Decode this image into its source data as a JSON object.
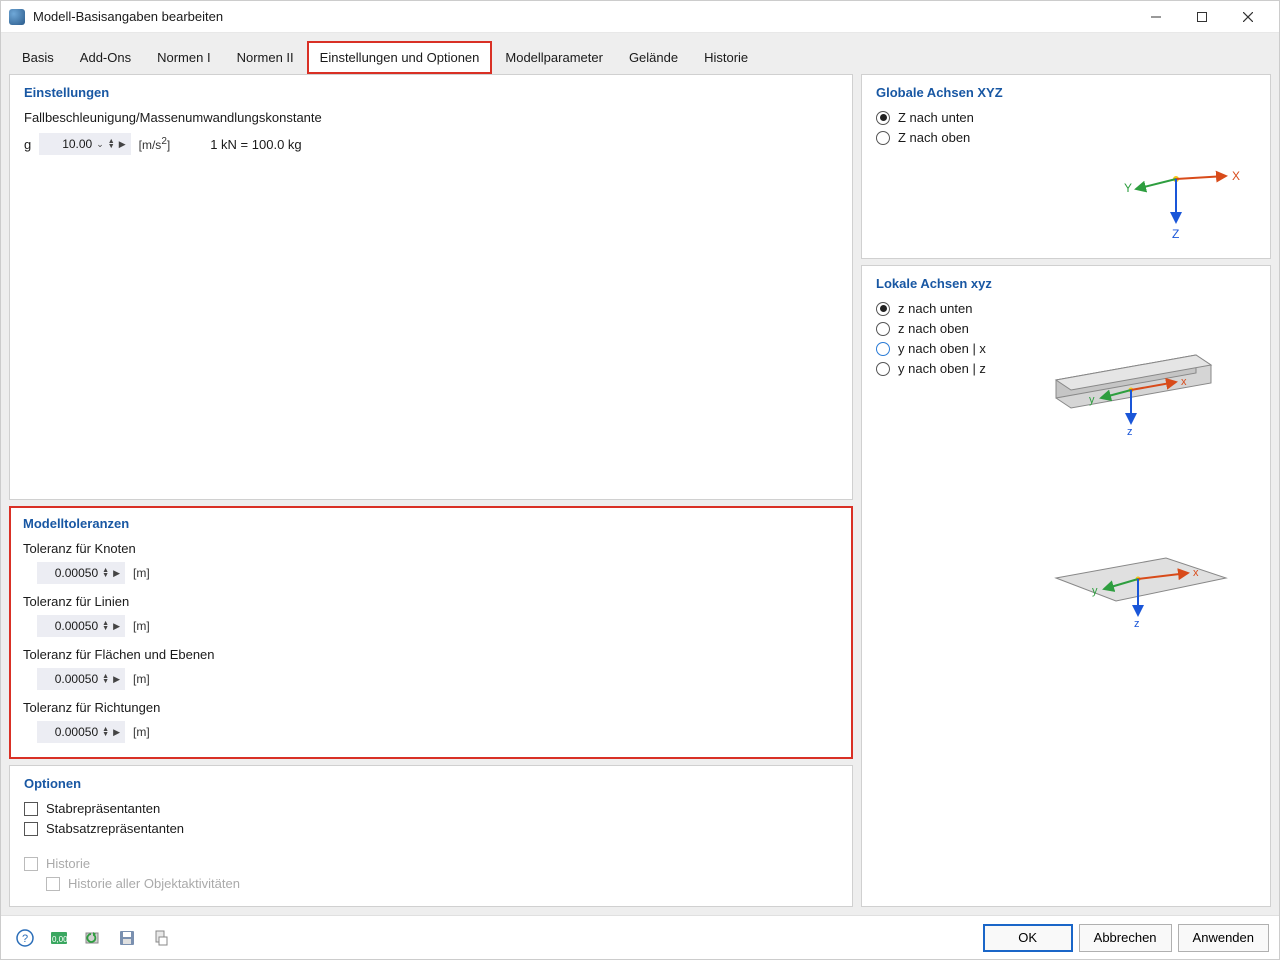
{
  "window": {
    "title": "Modell-Basisangaben bearbeiten"
  },
  "tabs": [
    {
      "label": "Basis"
    },
    {
      "label": "Add-Ons"
    },
    {
      "label": "Normen I"
    },
    {
      "label": "Normen II"
    },
    {
      "label": "Einstellungen und Optionen"
    },
    {
      "label": "Modellparameter"
    },
    {
      "label": "Gelände"
    },
    {
      "label": "Historie"
    }
  ],
  "settings": {
    "title": "Einstellungen",
    "gravity_label": "Fallbeschleunigung/Massenumwandlungskonstante",
    "g_symbol": "g",
    "g_value": "10.00",
    "g_unit": "[m/s²]",
    "kn_label": "1 kN = 100.0 kg"
  },
  "tolerances": {
    "title": "Modelltoleranzen",
    "items": [
      {
        "label": "Toleranz für Knoten",
        "value": "0.00050",
        "unit": "[m]"
      },
      {
        "label": "Toleranz für Linien",
        "value": "0.00050",
        "unit": "[m]"
      },
      {
        "label": "Toleranz für Flächen und Ebenen",
        "value": "0.00050",
        "unit": "[m]"
      },
      {
        "label": "Toleranz für Richtungen",
        "value": "0.00050",
        "unit": "[m]"
      }
    ]
  },
  "options": {
    "title": "Optionen",
    "items": [
      {
        "label": "Stabrepräsentanten",
        "checked": false,
        "disabled": false
      },
      {
        "label": "Stabsatzrepräsentanten",
        "checked": false,
        "disabled": false
      },
      {
        "label": "Historie",
        "checked": false,
        "disabled": true
      },
      {
        "label": "Historie aller Objektaktivitäten",
        "checked": false,
        "disabled": true,
        "indent": true
      }
    ]
  },
  "global_axes": {
    "title": "Globale Achsen XYZ",
    "options": [
      {
        "label": "Z nach unten",
        "checked": true
      },
      {
        "label": "Z nach oben",
        "checked": false
      }
    ]
  },
  "local_axes": {
    "title": "Lokale Achsen xyz",
    "options": [
      {
        "label": "z nach unten",
        "checked": true
      },
      {
        "label": "z nach oben",
        "checked": false
      },
      {
        "label": "y nach oben | x",
        "checked": false,
        "focus": true
      },
      {
        "label": "y nach oben | z",
        "checked": false
      }
    ]
  },
  "footer": {
    "ok": "OK",
    "cancel": "Abbrechen",
    "apply": "Anwenden"
  }
}
